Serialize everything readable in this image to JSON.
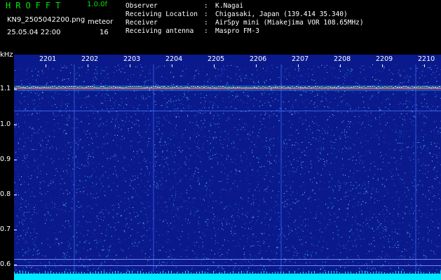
{
  "header": {
    "app_title": "HROFFT",
    "version": "1.0.0f",
    "filename": "KN9_2505042200.png",
    "datetime": "25.05.04 22:00",
    "meteor_label": "meteor",
    "meteor_count": "16"
  },
  "info": {
    "rows": [
      {
        "key": "Observer",
        "sep": ":",
        "value": "K.Nagai"
      },
      {
        "key": "Receiving Location",
        "sep": ":",
        "value": "Chigasaki, Japan (139.414 35.340)"
      },
      {
        "key": "Receiver",
        "sep": ":",
        "value": "AirSpy mini (Miakejima VOR 108.65MHz)"
      },
      {
        "key": "Receiving antenna",
        "sep": ":",
        "value": "Maspro FM-3"
      }
    ]
  },
  "axis": {
    "unit": "kHz",
    "y_ticks": [
      "1.1",
      "1.0",
      "0.9",
      "0.8",
      "0.7",
      "0.6"
    ],
    "x_ticks": [
      "2201",
      "2202",
      "2203",
      "2204",
      "2205",
      "2206",
      "2207",
      "2208",
      "2209",
      "2210"
    ]
  },
  "colors": {
    "background": "#000000",
    "plot_base": "#0a1a8c",
    "noise_bright": "#39d6ff",
    "signal_line": "#ff5a5a",
    "bottom_band": "#00e8ff",
    "title_green": "#00e600"
  }
}
